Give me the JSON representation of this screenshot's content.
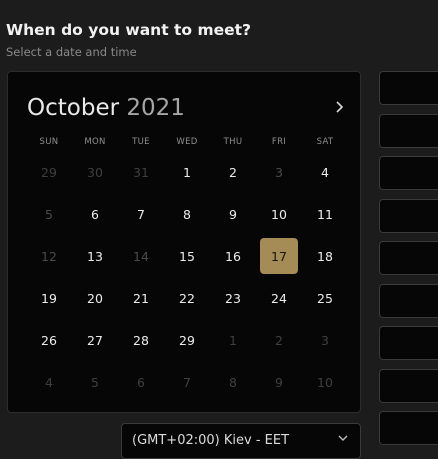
{
  "header": {
    "title": "When do you want to meet?",
    "subtitle": "Select a date and time"
  },
  "calendar": {
    "month": "October",
    "year": "2021",
    "next_icon": "chevron-right-icon",
    "weekdays": [
      "SUN",
      "MON",
      "TUE",
      "WED",
      "THU",
      "FRI",
      "SAT"
    ],
    "weeks": [
      [
        {
          "d": "29",
          "s": "out"
        },
        {
          "d": "30",
          "s": "out"
        },
        {
          "d": "31",
          "s": "out"
        },
        {
          "d": "1",
          "s": "avail"
        },
        {
          "d": "2",
          "s": "avail"
        },
        {
          "d": "3",
          "s": "disabled"
        },
        {
          "d": "4",
          "s": "avail"
        }
      ],
      [
        {
          "d": "5",
          "s": "disabled"
        },
        {
          "d": "6",
          "s": "avail"
        },
        {
          "d": "7",
          "s": "avail"
        },
        {
          "d": "8",
          "s": "avail"
        },
        {
          "d": "9",
          "s": "avail"
        },
        {
          "d": "10",
          "s": "avail"
        },
        {
          "d": "11",
          "s": "avail"
        }
      ],
      [
        {
          "d": "12",
          "s": "disabled"
        },
        {
          "d": "13",
          "s": "avail"
        },
        {
          "d": "14",
          "s": "disabled"
        },
        {
          "d": "15",
          "s": "avail"
        },
        {
          "d": "16",
          "s": "avail"
        },
        {
          "d": "17",
          "s": "selected"
        },
        {
          "d": "18",
          "s": "avail"
        }
      ],
      [
        {
          "d": "19",
          "s": "avail"
        },
        {
          "d": "20",
          "s": "avail"
        },
        {
          "d": "21",
          "s": "avail"
        },
        {
          "d": "22",
          "s": "avail"
        },
        {
          "d": "23",
          "s": "avail"
        },
        {
          "d": "24",
          "s": "avail"
        },
        {
          "d": "25",
          "s": "avail"
        }
      ],
      [
        {
          "d": "26",
          "s": "avail"
        },
        {
          "d": "27",
          "s": "avail"
        },
        {
          "d": "28",
          "s": "avail"
        },
        {
          "d": "29",
          "s": "avail"
        },
        {
          "d": "1",
          "s": "out"
        },
        {
          "d": "2",
          "s": "out"
        },
        {
          "d": "3",
          "s": "out"
        }
      ],
      [
        {
          "d": "4",
          "s": "out"
        },
        {
          "d": "5",
          "s": "out"
        },
        {
          "d": "6",
          "s": "out"
        },
        {
          "d": "7",
          "s": "out"
        },
        {
          "d": "8",
          "s": "out"
        },
        {
          "d": "9",
          "s": "out"
        },
        {
          "d": "10",
          "s": "out"
        }
      ]
    ],
    "colors": {
      "selected_bg": "#a58c57",
      "selected_text": "#1a1508",
      "out_text": "#3f3f3f"
    }
  },
  "timezone": {
    "value": "(GMT+02:00) Kiev - EET",
    "icon": "chevron-down-icon"
  },
  "time_slots": {
    "count_visible": 9
  }
}
